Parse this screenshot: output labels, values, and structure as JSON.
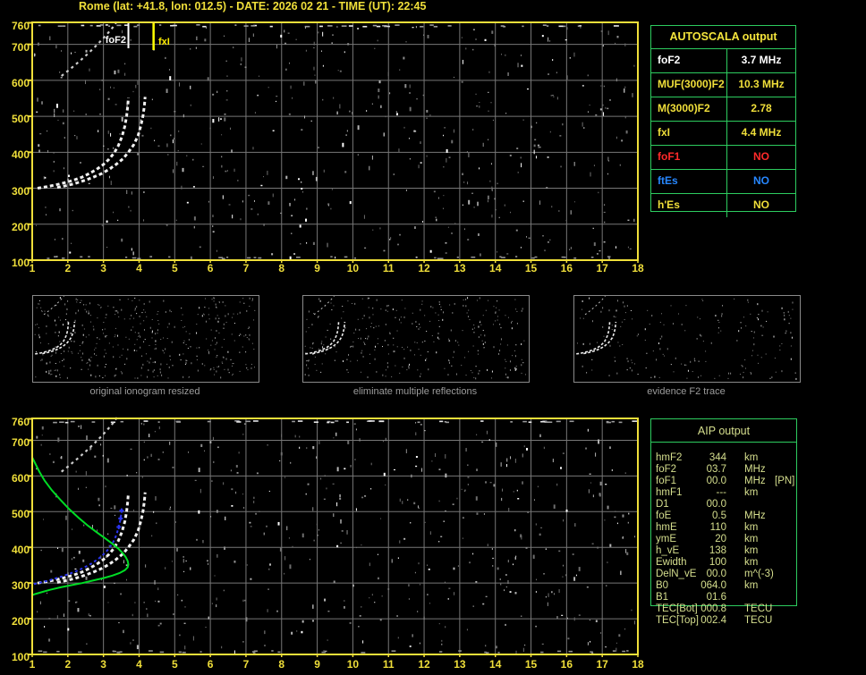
{
  "header": {
    "title": "Rome (lat: +41.8, lon: 012.5) - DATE: 2026 02 21 - TIME (UT): 22:45"
  },
  "colors": {
    "axis_yellow": "#f0df3a",
    "marker_yellow": "#ffff00",
    "table_border_green": "#2dcc5f",
    "autoscala_header_yellow": "#f5e53c",
    "aip_text": "#d6df8e",
    "trace_white": "#f2f2f2",
    "second_hop_gray": "#cccccc",
    "profile_green": "#00dd25",
    "restored_trace_blue": "#2b35f0",
    "value_white": "#ffffff",
    "value_red": "#ff2a2a",
    "value_blue": "#2787ff",
    "caption_gray": "#9c9c9c",
    "grid_gray": "#777777"
  },
  "autoscala": {
    "header": "AUTOSCALA output",
    "rows": [
      {
        "label": "foF2",
        "value": "3.7 MHz",
        "color": "#ffffff"
      },
      {
        "label": "MUF(3000)F2",
        "value": "10.3 MHz",
        "color": "#f0df3a"
      },
      {
        "label": "M(3000)F2",
        "value": "2.78",
        "color": "#f0df3a"
      },
      {
        "label": "fxI",
        "value": "4.4 MHz",
        "color": "#f0df3a"
      },
      {
        "label": "foF1",
        "value": "NO",
        "color": "#ff2a2a"
      },
      {
        "label": "ftEs",
        "value": "NO",
        "color": "#2787ff"
      },
      {
        "label": "h'Es",
        "value": "NO",
        "color": "#f0df3a"
      }
    ]
  },
  "aip": {
    "header": "AIP output",
    "rows": [
      {
        "label": "hmF2",
        "value": "344",
        "unit": "km",
        "extra": ""
      },
      {
        "label": "foF2",
        "value": "03.7",
        "unit": "MHz",
        "extra": ""
      },
      {
        "label": "foF1",
        "value": "00.0",
        "unit": "MHz",
        "extra": "[PN]"
      },
      {
        "label": "hmF1",
        "value": "---",
        "unit": "km",
        "extra": ""
      },
      {
        "label": "D1",
        "value": "00.0",
        "unit": "",
        "extra": ""
      },
      {
        "label": "foE",
        "value": "0.5",
        "unit": "MHz",
        "extra": ""
      },
      {
        "label": "hmE",
        "value": "110",
        "unit": "km",
        "extra": ""
      },
      {
        "label": "ymE",
        "value": "20",
        "unit": "km",
        "extra": ""
      },
      {
        "label": "h_vE",
        "value": "138",
        "unit": "km",
        "extra": ""
      },
      {
        "label": "Ewidth",
        "value": "100",
        "unit": "km",
        "extra": ""
      },
      {
        "label": "DelN_vE",
        "value": "00.0",
        "unit": "m^(-3)",
        "extra": ""
      },
      {
        "label": "B0",
        "value": "064.0",
        "unit": "km",
        "extra": ""
      },
      {
        "label": "B1",
        "value": "01.6",
        "unit": "",
        "extra": ""
      },
      {
        "label": "TEC[Bot]",
        "value": "000.8",
        "unit": "TECU",
        "extra": ""
      },
      {
        "label": "TEC[Top]",
        "value": "002.4",
        "unit": "TECU",
        "extra": ""
      }
    ]
  },
  "thumbnails": [
    {
      "label": "original ionogram resized"
    },
    {
      "label": "eliminate multiple reflections"
    },
    {
      "label": "evidence F2 trace"
    }
  ],
  "chart_data": [
    {
      "type": "scatter",
      "name": "scaled-ionogram",
      "x_unit": "MHz",
      "y_unit": "km",
      "xlim": [
        1,
        18
      ],
      "ylim": [
        100,
        760
      ],
      "xticks": [
        "1",
        "2",
        "3",
        "4",
        "5",
        "6",
        "7",
        "8",
        "9",
        "10",
        "11",
        "12",
        "13",
        "14",
        "15",
        "16",
        "17",
        "18"
      ],
      "ytick_values": [
        760,
        700,
        600,
        500,
        400,
        300,
        200,
        100
      ],
      "grid": true,
      "annotations": [
        {
          "text": "foF2",
          "x_mhz": 3.7,
          "color": "#ffffff"
        },
        {
          "text": "fxI",
          "x_mhz": 4.4,
          "color": "#ffff00"
        }
      ],
      "series": [
        {
          "name": "F2-trace-O-mode",
          "color": "#f2f2f2",
          "points": [
            [
              1.15,
              300
            ],
            [
              1.4,
              304
            ],
            [
              1.65,
              309
            ],
            [
              1.9,
              315
            ],
            [
              2.15,
              322
            ],
            [
              2.4,
              331
            ],
            [
              2.6,
              341
            ],
            [
              2.8,
              352
            ],
            [
              3.0,
              366
            ],
            [
              3.15,
              380
            ],
            [
              3.3,
              398
            ],
            [
              3.42,
              419
            ],
            [
              3.52,
              444
            ],
            [
              3.6,
              472
            ],
            [
              3.65,
              500
            ],
            [
              3.68,
              527
            ],
            [
              3.7,
              552
            ]
          ]
        },
        {
          "name": "F2-trace-X-mode",
          "color": "#f2f2f2",
          "points": [
            [
              1.7,
              302
            ],
            [
              1.95,
              307
            ],
            [
              2.2,
              313
            ],
            [
              2.45,
              321
            ],
            [
              2.7,
              330
            ],
            [
              2.95,
              341
            ],
            [
              3.15,
              352
            ],
            [
              3.35,
              366
            ],
            [
              3.55,
              382
            ],
            [
              3.7,
              400
            ],
            [
              3.85,
              421
            ],
            [
              3.97,
              446
            ],
            [
              4.05,
              474
            ],
            [
              4.11,
              502
            ],
            [
              4.15,
              530
            ],
            [
              4.17,
              554
            ]
          ]
        },
        {
          "name": "second-hop-trace",
          "color": "#cccccc",
          "points": [
            [
              1.82,
              612
            ],
            [
              2.0,
              626
            ],
            [
              2.18,
              641
            ],
            [
              2.36,
              656
            ],
            [
              2.54,
              672
            ],
            [
              2.72,
              689
            ],
            [
              2.9,
              707
            ],
            [
              3.08,
              726
            ],
            [
              3.26,
              747
            ],
            [
              3.38,
              764
            ]
          ]
        }
      ]
    },
    {
      "type": "scatter",
      "name": "ionogram-with-restored-trace-and-profile",
      "x_unit": "MHz",
      "y_unit": "km",
      "xlim": [
        1,
        18
      ],
      "ylim": [
        100,
        760
      ],
      "xticks": [
        "1",
        "2",
        "3",
        "4",
        "5",
        "6",
        "7",
        "8",
        "9",
        "10",
        "11",
        "12",
        "13",
        "14",
        "15",
        "16",
        "17",
        "18"
      ],
      "ytick_values": [
        760,
        700,
        600,
        500,
        400,
        300,
        200,
        100
      ],
      "grid": true,
      "annotations": [],
      "series": [
        {
          "name": "F2-trace-O-mode",
          "color": "#f2f2f2",
          "points": [
            [
              1.15,
              300
            ],
            [
              1.4,
              304
            ],
            [
              1.65,
              309
            ],
            [
              1.9,
              315
            ],
            [
              2.15,
              322
            ],
            [
              2.4,
              331
            ],
            [
              2.6,
              341
            ],
            [
              2.8,
              352
            ],
            [
              3.0,
              366
            ],
            [
              3.15,
              380
            ],
            [
              3.3,
              398
            ],
            [
              3.42,
              419
            ],
            [
              3.52,
              444
            ],
            [
              3.6,
              472
            ],
            [
              3.65,
              500
            ],
            [
              3.68,
              527
            ],
            [
              3.7,
              552
            ]
          ]
        },
        {
          "name": "F2-trace-X-mode",
          "color": "#f2f2f2",
          "points": [
            [
              1.7,
              302
            ],
            [
              1.95,
              307
            ],
            [
              2.2,
              313
            ],
            [
              2.45,
              321
            ],
            [
              2.7,
              330
            ],
            [
              2.95,
              341
            ],
            [
              3.15,
              352
            ],
            [
              3.35,
              366
            ],
            [
              3.55,
              382
            ],
            [
              3.7,
              400
            ],
            [
              3.85,
              421
            ],
            [
              3.97,
              446
            ],
            [
              4.05,
              474
            ],
            [
              4.11,
              502
            ],
            [
              4.15,
              530
            ],
            [
              4.17,
              554
            ]
          ]
        },
        {
          "name": "second-hop-trace",
          "color": "#cccccc",
          "points": [
            [
              1.82,
              612
            ],
            [
              2.0,
              626
            ],
            [
              2.18,
              641
            ],
            [
              2.36,
              656
            ],
            [
              2.54,
              672
            ],
            [
              2.72,
              689
            ],
            [
              2.9,
              707
            ],
            [
              3.08,
              726
            ],
            [
              3.26,
              747
            ],
            [
              3.38,
              764
            ]
          ]
        },
        {
          "name": "electron-density-profile",
          "color": "#00dd25",
          "points": [
            [
              1.0,
              652
            ],
            [
              1.08,
              636
            ],
            [
              1.2,
              612
            ],
            [
              1.35,
              587
            ],
            [
              1.55,
              560
            ],
            [
              1.8,
              532
            ],
            [
              2.05,
              506
            ],
            [
              2.3,
              483
            ],
            [
              2.55,
              462
            ],
            [
              2.8,
              443
            ],
            [
              3.05,
              425
            ],
            [
              3.25,
              410
            ],
            [
              3.42,
              396
            ],
            [
              3.55,
              383
            ],
            [
              3.63,
              372
            ],
            [
              3.68,
              362
            ],
            [
              3.7,
              352
            ],
            [
              3.68,
              344
            ],
            [
              3.6,
              336
            ],
            [
              3.45,
              328
            ],
            [
              3.25,
              321
            ],
            [
              3.0,
              314
            ],
            [
              2.7,
              307
            ],
            [
              2.4,
              300
            ],
            [
              2.1,
              294
            ],
            [
              1.8,
              288
            ],
            [
              1.5,
              281
            ],
            [
              1.25,
              274
            ],
            [
              1.08,
              269
            ],
            [
              1.0,
              266
            ]
          ]
        },
        {
          "name": "restored-O-trace",
          "color": "#2b35f0",
          "points": [
            [
              1.05,
              297
            ],
            [
              1.25,
              302
            ],
            [
              1.45,
              307
            ],
            [
              1.65,
              313
            ],
            [
              1.85,
              319
            ],
            [
              2.05,
              326
            ],
            [
              2.25,
              334
            ],
            [
              2.45,
              343
            ],
            [
              2.65,
              354
            ],
            [
              2.85,
              367
            ],
            [
              3.0,
              380
            ],
            [
              3.15,
              396
            ],
            [
              3.27,
              414
            ],
            [
              3.36,
              434
            ],
            [
              3.43,
              457
            ],
            [
              3.48,
              481
            ],
            [
              3.51,
              503
            ]
          ]
        }
      ]
    }
  ]
}
